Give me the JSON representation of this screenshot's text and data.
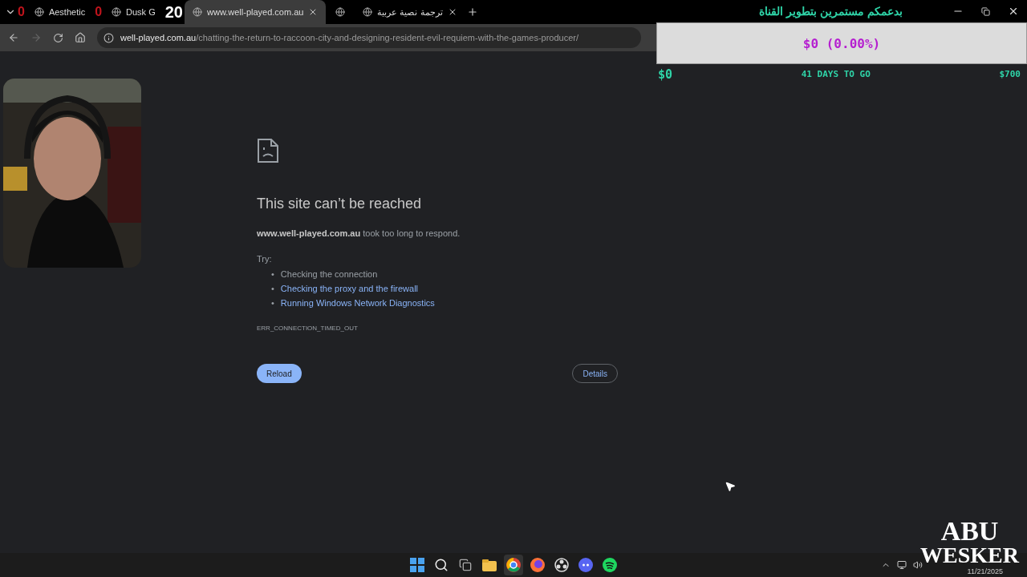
{
  "tabs": [
    {
      "title": "Aesthetic",
      "selected": false
    },
    {
      "title": "Dusk G",
      "selected": false
    },
    {
      "title": "www.well-played.com.au",
      "selected": true
    },
    {
      "selected": false
    },
    {
      "title": "ترجمة نصية عربية",
      "selected": false
    }
  ],
  "overlay_counters": [
    {
      "value": "0"
    },
    {
      "value": "0"
    },
    {
      "value": "20"
    }
  ],
  "address_bar": {
    "host": "well-played.com.au",
    "path": "/chatting-the-return-to-raccoon-city-and-designing-resident-evil-requiem-with-the-games-producer/"
  },
  "error_page": {
    "title": "This site can’t be reached",
    "message": "**www.well-played.com.au** took too long to respond.",
    "try_label": "Try:",
    "suggestions": [
      {
        "marker": "•",
        "text": "Checking the connection",
        "link": false
      },
      {
        "marker": "•",
        "text": "Checking the proxy and the firewall",
        "link": true
      },
      {
        "marker": "•",
        "text": "Running Windows Network Diagnostics",
        "link": true
      }
    ],
    "code": "ERR_CONNECTION_TIMED_OUT",
    "buttons": {
      "reload": "Reload",
      "details": "Details"
    }
  },
  "goal_widget": {
    "title": "بدعمكم مستمرين بتطوير القناة",
    "level": 0,
    "amount": "$0 (0.00%)",
    "start": "$0",
    "days_left": "41 DAYS TO GO",
    "target": "$700"
  },
  "taskbar": {
    "apps": [
      {
        "kind": "start",
        "active": false
      },
      {
        "kind": "search",
        "active": false
      },
      {
        "kind": "taskview",
        "active": false
      },
      {
        "kind": "folder",
        "active": false
      },
      {
        "kind": "chrome",
        "active": true
      },
      {
        "kind": "firefox",
        "active": false
      },
      {
        "kind": "obs",
        "active": false
      },
      {
        "kind": "discord",
        "active": false
      },
      {
        "kind": "spotify",
        "active": false
      }
    ],
    "date": "11/21/2025"
  },
  "logo": {
    "line1": "ABU",
    "line2": "WESKER"
  }
}
